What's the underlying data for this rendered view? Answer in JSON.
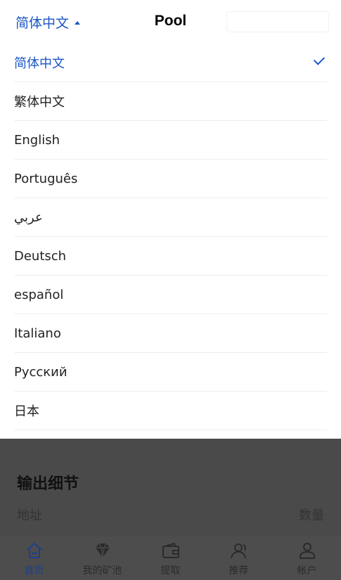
{
  "header": {
    "language_current": "简体中文",
    "title": "Pool"
  },
  "languages": [
    {
      "label": "简体中文",
      "selected": true
    },
    {
      "label": "繁体中文",
      "selected": false
    },
    {
      "label": "English",
      "selected": false
    },
    {
      "label": "Português",
      "selected": false
    },
    {
      "label": "عربي",
      "selected": false
    },
    {
      "label": "Deutsch",
      "selected": false
    },
    {
      "label": "español",
      "selected": false
    },
    {
      "label": "Italiano",
      "selected": false
    },
    {
      "label": "Русский",
      "selected": false
    },
    {
      "label": "日本",
      "selected": false
    }
  ],
  "output_section": {
    "title": "输出细节",
    "col_address": "地址",
    "col_quantity": "数量"
  },
  "bottom_nav": {
    "items": [
      {
        "label": "首页",
        "icon": "home-icon",
        "active": true
      },
      {
        "label": "我的矿池",
        "icon": "diamond-icon",
        "active": false
      },
      {
        "label": "提取",
        "icon": "wallet-icon",
        "active": false
      },
      {
        "label": "推荐",
        "icon": "users-icon",
        "active": false
      },
      {
        "label": "帐户",
        "icon": "user-icon",
        "active": false
      }
    ]
  },
  "colors": {
    "accent": "#1a56c7",
    "overlay": "#4a4a4a"
  }
}
